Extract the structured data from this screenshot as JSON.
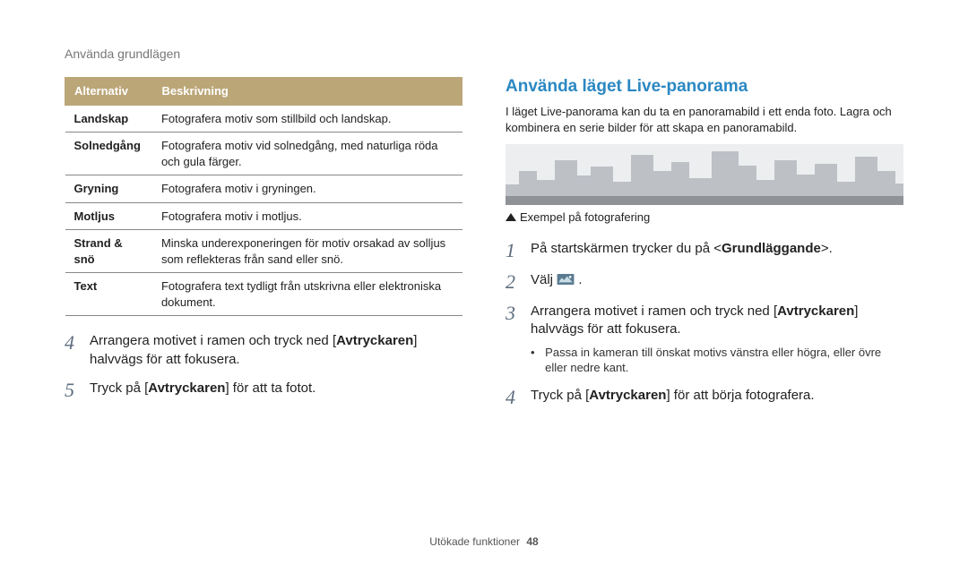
{
  "header": "Använda grundlägen",
  "table": {
    "headers": [
      "Alternativ",
      "Beskrivning"
    ],
    "rows": [
      {
        "option": "Landskap",
        "desc": "Fotografera motiv som stillbild och landskap."
      },
      {
        "option": "Solnedgång",
        "desc": "Fotografera motiv vid solnedgång, med naturliga röda och gula färger."
      },
      {
        "option": "Gryning",
        "desc": "Fotografera motiv i gryningen."
      },
      {
        "option": "Motljus",
        "desc": "Fotografera motiv i motljus."
      },
      {
        "option": "Strand & snö",
        "desc": "Minska underexponeringen för motiv orsakad av solljus som reflekteras från sand eller snö."
      },
      {
        "option": "Text",
        "desc": "Fotografera text tydligt från utskrivna eller elektroniska dokument."
      }
    ]
  },
  "left_steps": {
    "4": {
      "pre": "Arrangera motivet i ramen och tryck ned [",
      "bold": "Avtryckaren",
      "post": "] halvvägs för att fokusera."
    },
    "5": {
      "pre": "Tryck på [",
      "bold": "Avtryckaren",
      "post": "] för att ta fotot."
    }
  },
  "right": {
    "title": "Använda läget Live-panorama",
    "intro": "I läget Live-panorama kan du ta en panoramabild i ett enda foto. Lagra och kombinera en serie bilder för att skapa en panoramabild.",
    "caption": "Exempel på fotografering",
    "steps": {
      "1": {
        "pre": "På startskärmen trycker du på <",
        "bold": "Grundläggande",
        "post": ">."
      },
      "2": {
        "pre": "Välj ",
        "bold": "",
        "post": "",
        "has_icon": true
      },
      "3": {
        "pre": "Arrangera motivet i ramen och tryck ned [",
        "bold": "Avtryckaren",
        "post": "] halvvägs för att fokusera.",
        "sub": "Passa in kameran till önskat motivs vänstra eller högra, eller övre eller nedre kant."
      },
      "4": {
        "pre": "Tryck på [",
        "bold": "Avtryckaren",
        "post": "] för att börja fotografera."
      }
    }
  },
  "footer": {
    "text": "Utökade funktioner",
    "page": "48"
  },
  "colors": {
    "accent": "#2b88c2",
    "table_head": "#bba678"
  }
}
